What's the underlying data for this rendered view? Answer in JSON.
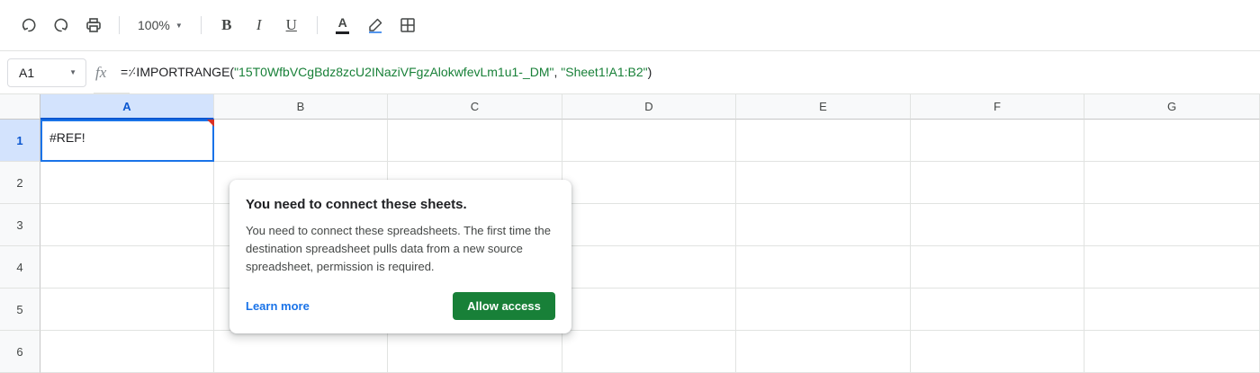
{
  "toolbar": {
    "undo_icon": "undo-icon",
    "redo_icon": "redo-icon",
    "print_icon": "print-icon",
    "zoom_value": "100%",
    "bold_label": "B",
    "italic_label": "I",
    "underline_label": "U",
    "text_color_label": "A",
    "text_color": "#202124"
  },
  "formula_bar": {
    "cell_ref": "A1",
    "fx_label": "fx",
    "formula_prefix": "=⸓IMPORTRANGE(",
    "formula_arg1": "\"15T0WfbVCgBdz8zcU2INaziVFgzAlokwfevLm1u1-_DM\"",
    "formula_sep": ", ",
    "formula_arg2": "\"Sheet1!A1:B2\"",
    "formula_suffix": ")"
  },
  "grid": {
    "columns": [
      "A",
      "B",
      "C",
      "D",
      "E",
      "F",
      "G"
    ],
    "rows": [
      "1",
      "2",
      "3",
      "4",
      "5",
      "6"
    ],
    "selected_column": "A",
    "selected_row": "1",
    "active_cell_value": "#REF!"
  },
  "popup": {
    "title": "You need to connect these sheets.",
    "body": "You need to connect these spreadsheets. The first time the destination spreadsheet pulls data from a new source spreadsheet, permission is required.",
    "learn_more": "Learn more",
    "allow_access": "Allow access"
  },
  "colors": {
    "accent_blue": "#1a73e8",
    "allow_green": "#188038",
    "error_red": "#d93025"
  }
}
